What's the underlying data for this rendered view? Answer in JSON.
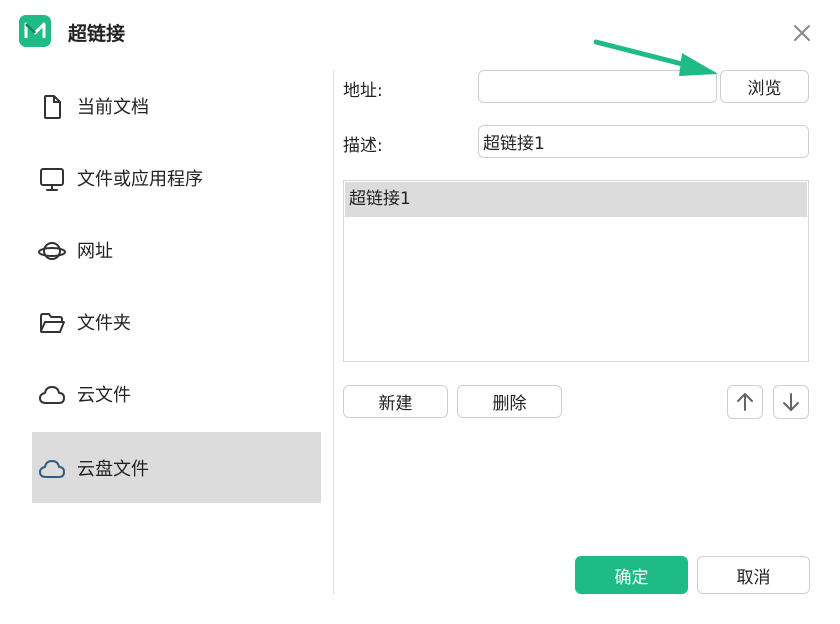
{
  "dialog": {
    "title": "超链接",
    "close_icon": "close-icon",
    "accent_color": "#1fbb86"
  },
  "sidebar": {
    "items": [
      {
        "label": "当前文档",
        "icon": "document-icon",
        "active": false
      },
      {
        "label": "文件或应用程序",
        "icon": "monitor-icon",
        "active": false
      },
      {
        "label": "网址",
        "icon": "planet-icon",
        "active": false
      },
      {
        "label": "文件夹",
        "icon": "folder-icon",
        "active": false
      },
      {
        "label": "云文件",
        "icon": "cloud-icon",
        "active": false
      },
      {
        "label": "云盘文件",
        "icon": "cloud-drive-icon",
        "active": true
      }
    ]
  },
  "form": {
    "address_label": "地址:",
    "address_value": "",
    "browse_label": "浏览",
    "description_label": "描述:",
    "description_value": "超链接1"
  },
  "list": {
    "items": [
      "超链接1"
    ]
  },
  "actions": {
    "new_label": "新建",
    "delete_label": "删除",
    "up_icon": "arrow-up-icon",
    "down_icon": "arrow-down-icon"
  },
  "footer": {
    "ok_label": "确定",
    "cancel_label": "取消"
  }
}
